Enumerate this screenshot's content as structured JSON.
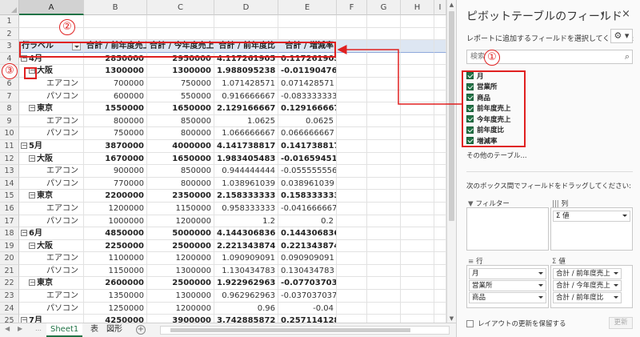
{
  "sheet": {
    "columns": [
      "A",
      "B",
      "C",
      "D",
      "E",
      "F",
      "G",
      "H",
      "I"
    ],
    "header_row": {
      "row_label": "行ラベル",
      "c1": "合計 / 前年度売上",
      "c2": "合計 / 今年度売上",
      "c3": "合計 / 前年度比",
      "c4": "合計 / 増減率"
    },
    "rows": [
      {
        "num": "1",
        "type": "empty"
      },
      {
        "num": "2",
        "type": "empty"
      },
      {
        "num": "3",
        "type": "header"
      },
      {
        "num": "4",
        "type": "lvl0",
        "label": "4月",
        "prev": "2850000",
        "curr": "2950000",
        "ratio": "4.117261905",
        "change": "0.117261905"
      },
      {
        "num": "5",
        "type": "lvl1",
        "label": "大阪",
        "prev": "1300000",
        "curr": "1300000",
        "ratio": "1.988095238",
        "change": "-0.011904762"
      },
      {
        "num": "6",
        "type": "lvl2",
        "label": "エアコン",
        "prev": "700000",
        "curr": "750000",
        "ratio": "1.071428571",
        "change": "0.071428571"
      },
      {
        "num": "7",
        "type": "lvl2",
        "label": "パソコン",
        "prev": "600000",
        "curr": "550000",
        "ratio": "0.916666667",
        "change": "-0.083333333"
      },
      {
        "num": "8",
        "type": "lvl1",
        "label": "東京",
        "prev": "1550000",
        "curr": "1650000",
        "ratio": "2.129166667",
        "change": "0.129166667"
      },
      {
        "num": "9",
        "type": "lvl2",
        "label": "エアコン",
        "prev": "800000",
        "curr": "850000",
        "ratio": "1.0625",
        "change": "0.0625"
      },
      {
        "num": "10",
        "type": "lvl2",
        "label": "パソコン",
        "prev": "750000",
        "curr": "800000",
        "ratio": "1.066666667",
        "change": "0.066666667"
      },
      {
        "num": "11",
        "type": "lvl0",
        "label": "5月",
        "prev": "3870000",
        "curr": "4000000",
        "ratio": "4.141738817",
        "change": "0.141738817"
      },
      {
        "num": "12",
        "type": "lvl1",
        "label": "大阪",
        "prev": "1670000",
        "curr": "1650000",
        "ratio": "1.983405483",
        "change": "-0.016594517"
      },
      {
        "num": "13",
        "type": "lvl2",
        "label": "エアコン",
        "prev": "900000",
        "curr": "850000",
        "ratio": "0.944444444",
        "change": "-0.055555556"
      },
      {
        "num": "14",
        "type": "lvl2",
        "label": "パソコン",
        "prev": "770000",
        "curr": "800000",
        "ratio": "1.038961039",
        "change": "0.038961039"
      },
      {
        "num": "15",
        "type": "lvl1",
        "label": "東京",
        "prev": "2200000",
        "curr": "2350000",
        "ratio": "2.158333333",
        "change": "0.158333333"
      },
      {
        "num": "16",
        "type": "lvl2",
        "label": "エアコン",
        "prev": "1200000",
        "curr": "1150000",
        "ratio": "0.958333333",
        "change": "-0.041666667"
      },
      {
        "num": "17",
        "type": "lvl2",
        "label": "パソコン",
        "prev": "1000000",
        "curr": "1200000",
        "ratio": "1.2",
        "change": "0.2"
      },
      {
        "num": "18",
        "type": "lvl0",
        "label": "6月",
        "prev": "4850000",
        "curr": "5000000",
        "ratio": "4.144306836",
        "change": "0.144306836"
      },
      {
        "num": "19",
        "type": "lvl1",
        "label": "大阪",
        "prev": "2250000",
        "curr": "2500000",
        "ratio": "2.221343874",
        "change": "0.221343874"
      },
      {
        "num": "20",
        "type": "lvl2",
        "label": "エアコン",
        "prev": "1100000",
        "curr": "1200000",
        "ratio": "1.090909091",
        "change": "0.090909091"
      },
      {
        "num": "21",
        "type": "lvl2",
        "label": "パソコン",
        "prev": "1150000",
        "curr": "1300000",
        "ratio": "1.130434783",
        "change": "0.130434783"
      },
      {
        "num": "22",
        "type": "lvl1",
        "label": "東京",
        "prev": "2600000",
        "curr": "2500000",
        "ratio": "1.922962963",
        "change": "-0.077037037"
      },
      {
        "num": "23",
        "type": "lvl2",
        "label": "エアコン",
        "prev": "1350000",
        "curr": "1300000",
        "ratio": "0.962962963",
        "change": "-0.037037037"
      },
      {
        "num": "24",
        "type": "lvl2",
        "label": "パソコン",
        "prev": "1250000",
        "curr": "1200000",
        "ratio": "0.96",
        "change": "-0.04"
      },
      {
        "num": "25",
        "type": "lvl0",
        "label": "7月",
        "prev": "4250000",
        "curr": "3900000",
        "ratio": "3.742885872",
        "change": "0.257114128"
      }
    ],
    "tabs": [
      {
        "label": "Sheet1",
        "active": true
      },
      {
        "label": "表",
        "active": false
      },
      {
        "label": "図形",
        "active": false
      }
    ],
    "collapse_glyph": "−",
    "add_sheet_glyph": "+"
  },
  "pane": {
    "title": "ピボットテーブルのフィールド",
    "subtitle": "レポートに追加するフィールドを選択してください:",
    "menu_glyph": "▾",
    "close_glyph": "×",
    "gear_glyph": "⚙ ▾",
    "search_placeholder": "検索",
    "search_icon": "⌕",
    "fields": [
      "月",
      "営業所",
      "商品",
      "前年度売上",
      "今年度売上",
      "前年度比",
      "増減率"
    ],
    "other_tables": "その他のテーブル...",
    "drag_hint": "次のボックス間でフィールドをドラッグしてください:",
    "areas": {
      "filter": {
        "icon": "▼",
        "label": "フィルター"
      },
      "columns": {
        "icon": "|||",
        "label": "列",
        "items": [
          "Σ 値"
        ]
      },
      "rows": {
        "icon": "≡",
        "label": "行",
        "items": [
          "月",
          "営業所",
          "商品"
        ]
      },
      "values": {
        "icon": "Σ",
        "label": "値",
        "items": [
          "合計 / 前年度売上",
          "合計 / 今年度売上",
          "合計 / 前年度比"
        ]
      }
    },
    "defer_label": "レイアウトの更新を保留する",
    "update_label": "更新"
  },
  "annotations": {
    "badge1": "①",
    "badge2": "②",
    "badge3": "③",
    "color": "#e02020"
  }
}
